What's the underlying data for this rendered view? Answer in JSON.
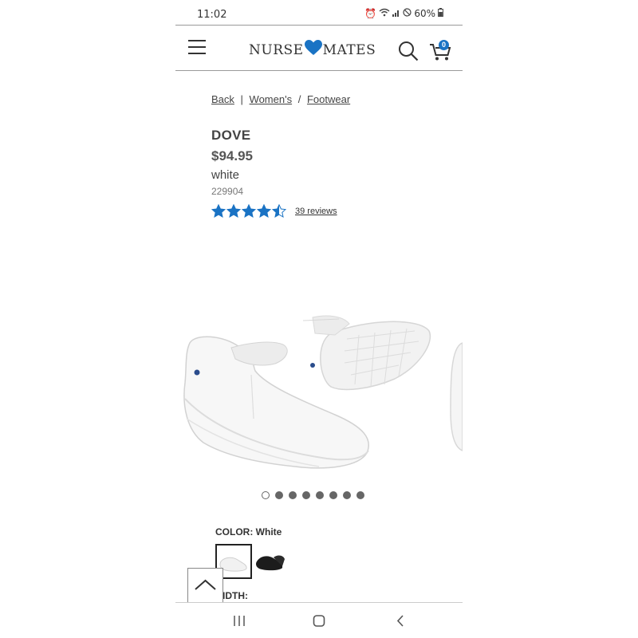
{
  "status_bar": {
    "time": "11:02",
    "battery": "60%"
  },
  "header": {
    "logo_left": "NURSE",
    "logo_right": "MATES",
    "cart_count": "0"
  },
  "breadcrumb": {
    "back": "Back",
    "sep1": "|",
    "womens": "Women's",
    "sep2": "/",
    "footwear": "Footwear"
  },
  "product": {
    "name": "DOVE",
    "price": "$94.95",
    "color": "white",
    "sku": "229904",
    "rating": 4.5,
    "reviews": "39 reviews"
  },
  "carousel": {
    "total_slides": 8,
    "active_index": 0
  },
  "options": {
    "color_label": "COLOR: White",
    "width_label": "IDTH:"
  },
  "colors": {
    "accent": "#1a73c4",
    "text": "#444444"
  }
}
